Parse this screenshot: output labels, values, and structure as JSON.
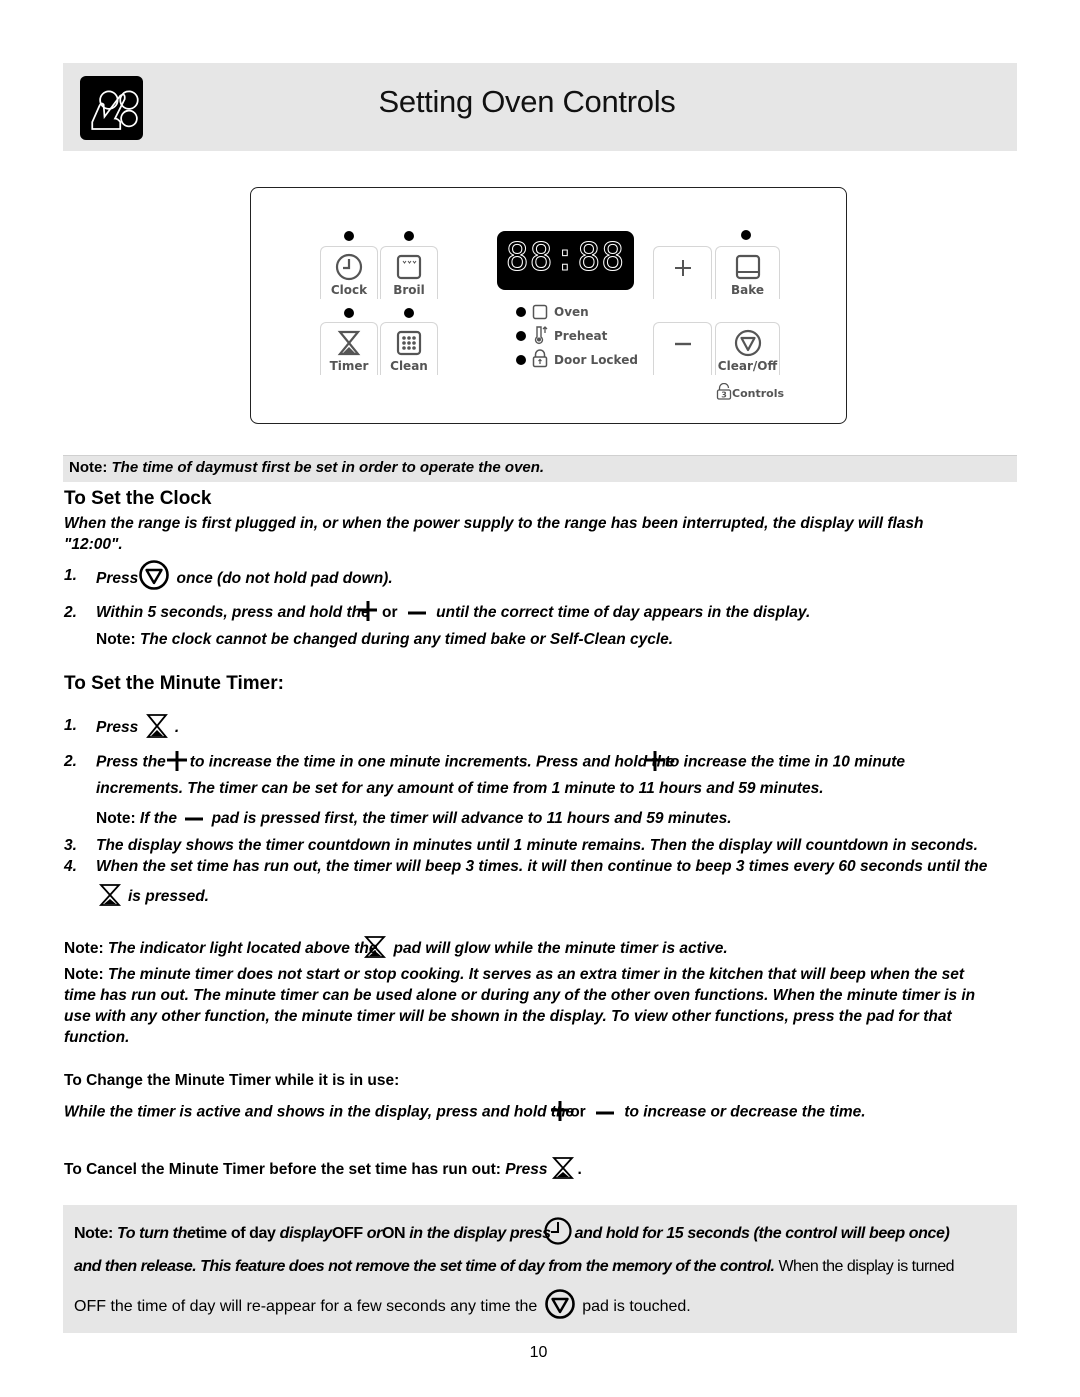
{
  "header": {
    "title": "Setting Oven Controls",
    "logo_icon": "hand-touch-pad-icon"
  },
  "panel": {
    "pads_left": [
      {
        "label": "Clock",
        "icon": "clock-icon",
        "indicator": true
      },
      {
        "label": "Broil",
        "icon": "broil-icon",
        "indicator": true
      },
      {
        "label": "Timer",
        "icon": "hourglass-icon",
        "indicator": true
      },
      {
        "label": "Clean",
        "icon": "clean-grid-icon",
        "indicator": true
      }
    ],
    "display": "88:88",
    "indicators": [
      {
        "label": "Oven",
        "icon": "oven-square-icon"
      },
      {
        "label": "Preheat",
        "icon": "thermometer-icon"
      },
      {
        "label": "Door Locked",
        "icon": "lock-icon"
      }
    ],
    "plus_label": "+",
    "minus_label": "−",
    "pads_right": [
      {
        "label": "Bake",
        "icon": "bake-icon",
        "indicator": true
      },
      {
        "label": "Clear/Off",
        "icon": "clear-off-icon",
        "indicator": false
      }
    ],
    "controls_lock": {
      "label": "Controls",
      "badge": "3"
    }
  },
  "note_top": {
    "prefix": "Note:",
    "text_a": "The time of day",
    "text_b": "must first be set in order to operate the oven."
  },
  "set_clock": {
    "heading": "To Set the Clock",
    "intro_line1": "When the range is first plugged in, or when the power supply to the range has been interrupted, the display will flash",
    "intro_line2": "\"12:00\".",
    "steps": [
      {
        "num": "1.",
        "pre": "Press",
        "post": "once (do not hold pad down)."
      },
      {
        "num": "2.",
        "pre": "Within 5 seconds, press and hold the",
        "mid": "or",
        "post": "until the correct time of day appears in the display."
      }
    ],
    "note_prefix": "Note:",
    "note_text": "The clock cannot be changed during any timed bake or Self-Clean cycle."
  },
  "set_timer": {
    "heading": "To Set the Minute Timer:",
    "step1": {
      "num": "1.",
      "pre": "Press",
      "post": "."
    },
    "step2": {
      "num": "2.",
      "pre": "Press the",
      "mid": "to increase the time in one minute increments. Press and hold the",
      "post": "to increase the time in 10 minute",
      "line2": "increments. The timer can be set for any amount of time from 1 minute to 11 hours and 59 minutes."
    },
    "note_prefix": "Note:",
    "note_pre": "If the",
    "note_post": "pad is pressed first, the timer will advance to 11 hours and 59 minutes.",
    "step3": {
      "num": "3.",
      "text": "The display shows the timer countdown in minutes until 1 minute remains. Then the display will countdown in seconds."
    },
    "step4": {
      "num": "4.",
      "text": "When the set time has run out, the timer will beep 3 times. it will then continue to beep 3 times every 60 seconds until the",
      "line2": "is pressed."
    }
  },
  "notes": {
    "indicator_prefix": "Note:",
    "indicator_pre": "The indicator light located above the",
    "indicator_post": "pad will glow while the minute timer is active.",
    "minute_prefix": "Note:",
    "minute_lines": [
      "The minute timer does not start or stop cooking. It serves as an extra timer in the kitchen that will beep when the set",
      "time has run out. The minute timer can be used alone or during any of the other oven functions. When the minute timer is in",
      "use with any other function, the minute timer will be shown in the display. To view other functions, press the pad for that",
      "function."
    ]
  },
  "change_timer": {
    "heading": "To Change the Minute Timer while it is in use:",
    "pre": "While the timer is active and shows in the display, press and hold the",
    "mid": "or",
    "post": "to increase or decrease the time."
  },
  "cancel_timer": {
    "heading": "To Cancel the Minute Timer before the set time has run out:",
    "press": "Press",
    "end": "."
  },
  "display_note": {
    "prefix": "Note:",
    "l1_a": "To turn the",
    "l1_b": "time of day",
    "l1_c": "display",
    "l1_d": "OFF",
    "l1_e": "or",
    "l1_f": "ON",
    "l1_g": "in the display press",
    "l1_h": "and hold for 15 seconds (the control will beep once)",
    "l2_a": "and then release. This feature does not remove the set time of day from the memory of the control.",
    "l2_b": "When the display is turned",
    "l3_a": "OFF the time of day will re-appear for a few seconds any time the",
    "l3_b": "pad is touched."
  },
  "page_number": "10"
}
